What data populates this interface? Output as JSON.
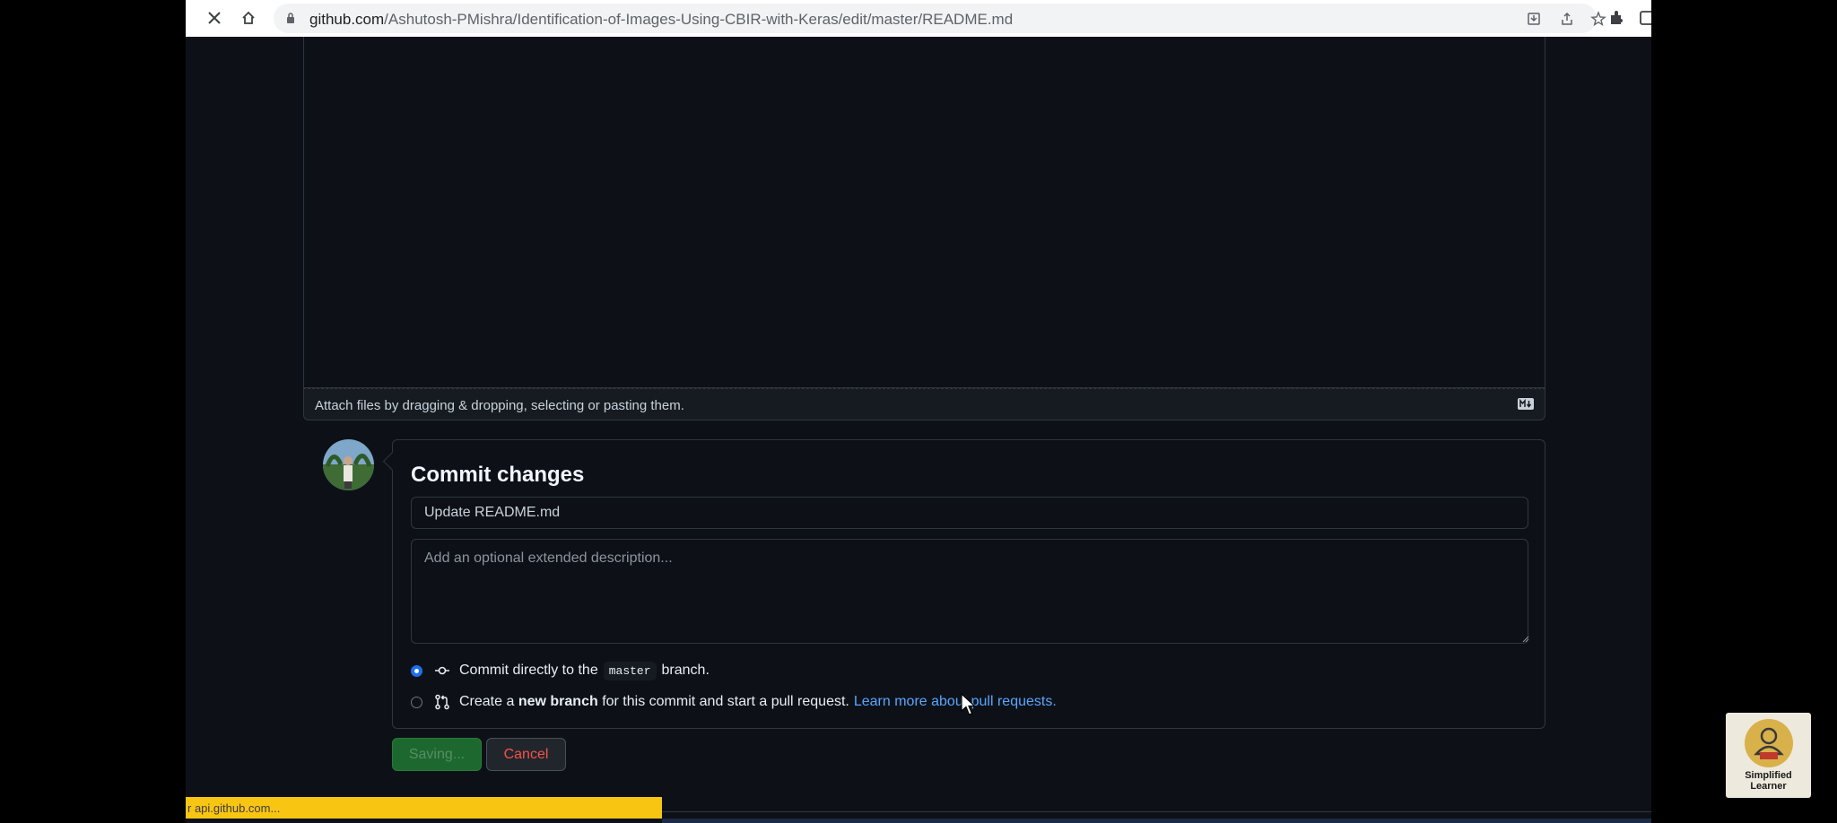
{
  "browser": {
    "url_host": "github.com",
    "url_path": "/Ashutosh-PMishra/Identification-of-Images-Using-CBIR-with-Keras/edit/master/README.md"
  },
  "editor": {
    "attach_hint": "Attach files by dragging & dropping, selecting or pasting them.",
    "markdown_icon": "markdown-icon"
  },
  "commit": {
    "title": "Commit changes",
    "summary_value": "Update README.md",
    "description_placeholder": "Add an optional extended description...",
    "option_direct": {
      "prefix": "Commit directly to the",
      "branch": "master",
      "suffix": "branch.",
      "selected": true
    },
    "option_new_branch": {
      "prefix": "Create a",
      "bold": "new branch",
      "suffix": "for this commit and start a pull request.",
      "link": "Learn more about pull requests.",
      "selected": false
    }
  },
  "buttons": {
    "save": "Saving...",
    "cancel": "Cancel"
  },
  "status_bar": {
    "text": "r api.github.com..."
  },
  "watermark": {
    "line1": "Simplified",
    "line2": "Learner"
  },
  "colors": {
    "background": "#0d1117",
    "accent_blue": "#58a6ff",
    "success_green": "#238636",
    "danger_red": "#f85149",
    "status_yellow": "#f9c513"
  }
}
